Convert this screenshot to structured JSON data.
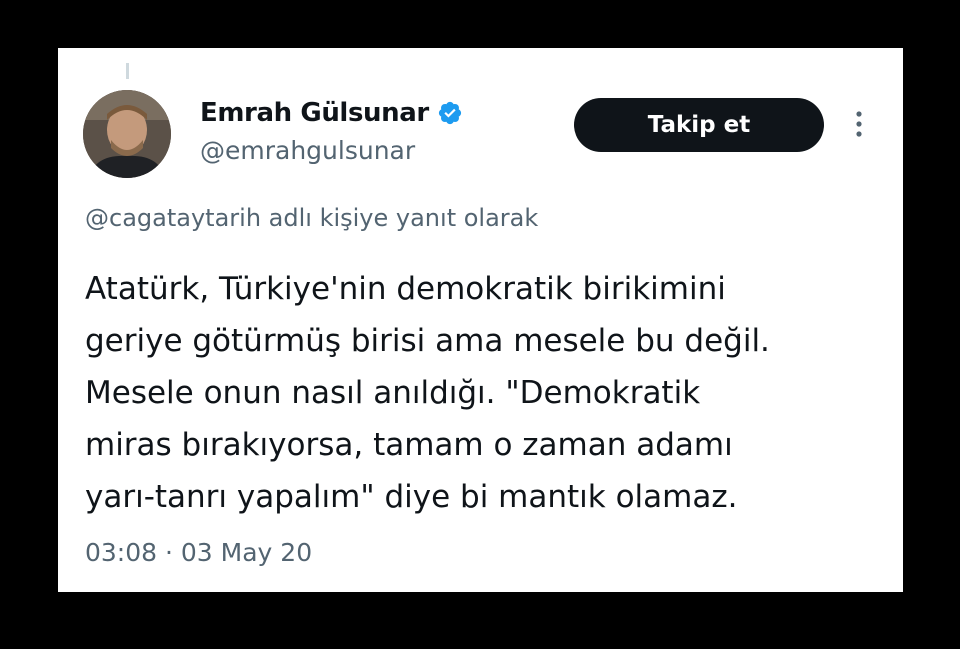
{
  "user": {
    "display_name": "Emrah Gülsunar",
    "handle": "@emrahgulsunar",
    "verified_icon": "verified-badge-icon",
    "avatar_icon": "profile-photo"
  },
  "actions": {
    "follow_label": "Takip et",
    "more_icon": "more-vertical-icon"
  },
  "reply_context": "@cagataytarih adlı kişiye yanıt olarak",
  "tweet": {
    "lines": [
      "Atatürk, Türkiye'nin demokratik birikimini",
      "geriye götürmüş birisi ama mesele bu değil.",
      "Mesele onun nasıl anıldığı. \"Demokratik",
      "miras bırakıyorsa, tamam o zaman adamı",
      "yarı-tanrı yapalım\" diye bi mantık olamaz."
    ]
  },
  "meta": {
    "time": "03:08",
    "separator": "·",
    "date": "03 May 20"
  },
  "colors": {
    "background": "#000000",
    "card": "#ffffff",
    "text_primary": "#0f1419",
    "text_secondary": "#536471",
    "verified_blue": "#1d9bf0",
    "button_bg": "#0f1419"
  }
}
